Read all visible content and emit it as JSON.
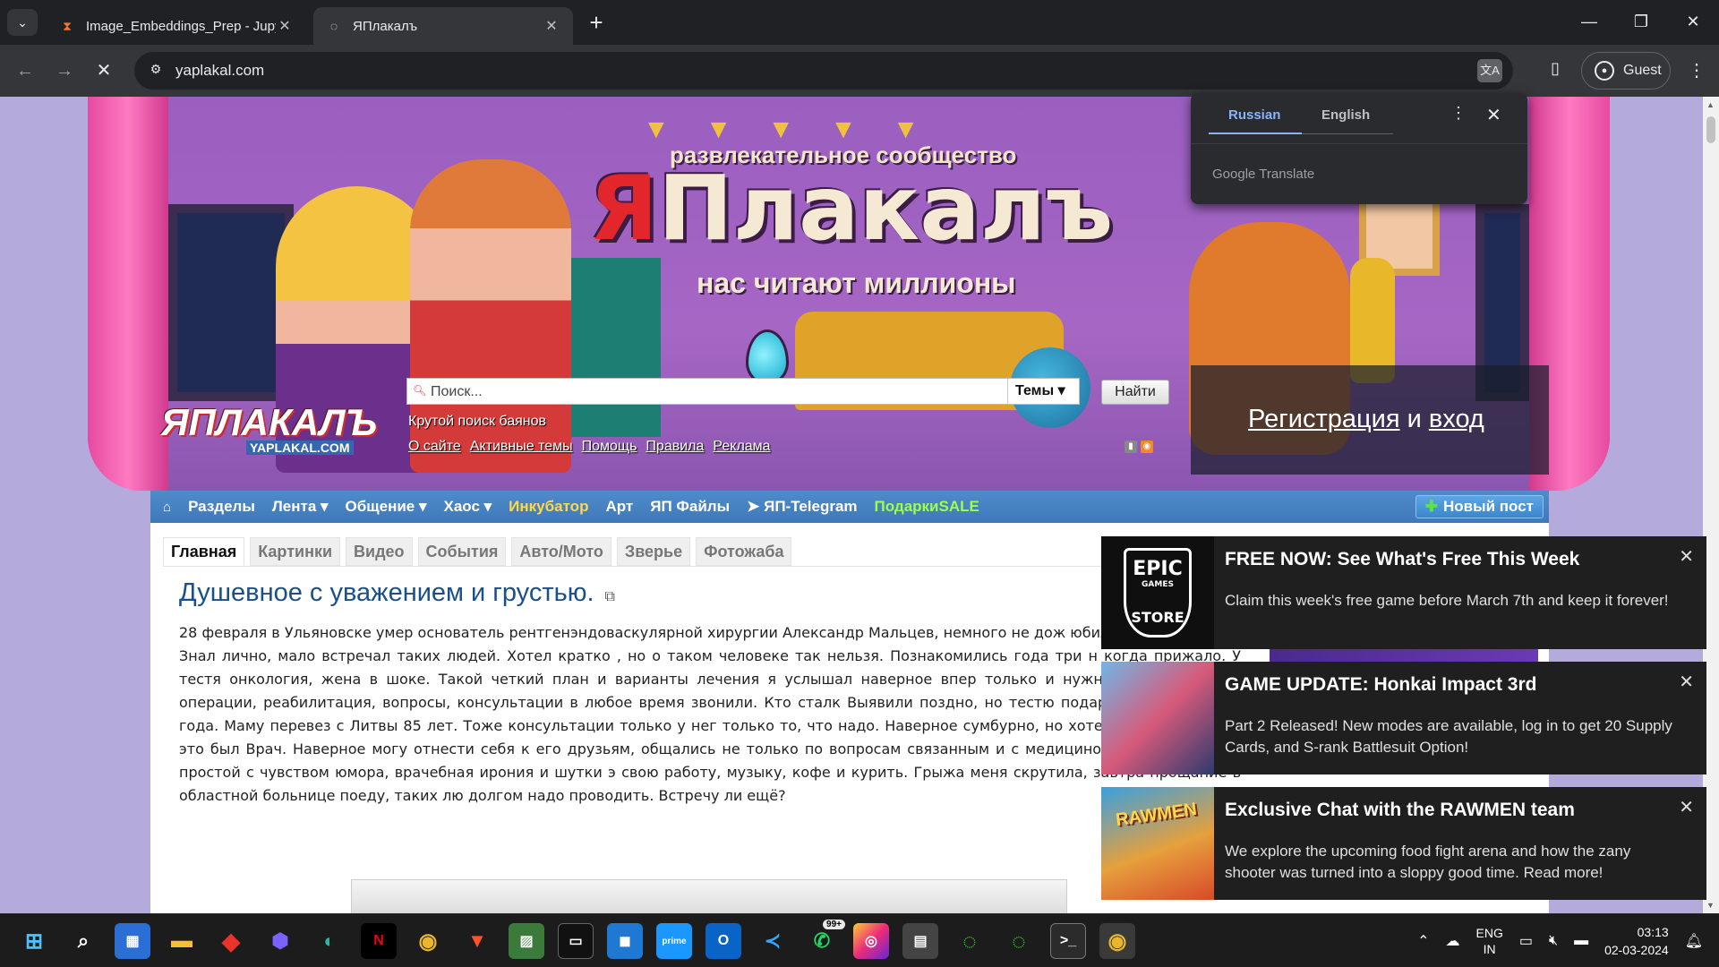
{
  "browser": {
    "tabs": [
      {
        "title": "Image_Embeddings_Prep - Jupy",
        "favicon": "hourglass-icon",
        "active": false
      },
      {
        "title": "ЯПлакалъ",
        "favicon": "loading-icon",
        "active": true
      }
    ],
    "url": "yaplakal.com",
    "profile_label": "Guest"
  },
  "translate_popup": {
    "source_lang": "Russian",
    "target_lang": "English",
    "brand": "Google Translate"
  },
  "banner": {
    "tagline_top": "развлекательное сообщество",
    "brand_first": "Я",
    "brand_rest": "Плакалъ",
    "tagline_bottom": "нас читают миллионы",
    "small_logo_main": "ЯПЛАКАЛ",
    "small_logo_end": "Ъ",
    "small_logo_domain": "YAPLAKAL.COM"
  },
  "search": {
    "placeholder": "Поиск...",
    "scope": "Темы",
    "button": "Найти",
    "subtitle": "Крутой поиск баянов"
  },
  "top_links": [
    "О сайте",
    "Активные темы",
    "Помощь",
    "Правила",
    "Реклама"
  ],
  "auth": {
    "register": "Регистрация",
    "and": "и",
    "login": "вход"
  },
  "nav": {
    "items": [
      {
        "label": "Разделы",
        "style": "normal"
      },
      {
        "label": "Лента ▾",
        "style": "normal"
      },
      {
        "label": "Общение ▾",
        "style": "normal"
      },
      {
        "label": "Хаос ▾",
        "style": "normal"
      },
      {
        "label": "Инкубатор",
        "style": "yellow"
      },
      {
        "label": "Арт",
        "style": "normal"
      },
      {
        "label": "ЯП Файлы",
        "style": "normal"
      },
      {
        "label": "ЯП-Telegram",
        "style": "normal"
      },
      {
        "label": "ПодаркиSALE",
        "style": "green"
      }
    ],
    "new_post": "Новый пост"
  },
  "content_tabs": [
    "Главная",
    "Картинки",
    "Видео",
    "События",
    "Авто/Мото",
    "Зверье",
    "Фотожаба"
  ],
  "post": {
    "title": "Душевное с уважением и грустью.",
    "paragraphs": [
      "28 февраля в Ульяновске умер основатель рентгенэндоваскулярной хирургии Александр Мальцев, немного не дож юбилея.",
      "Знал лично, мало встречал таких людей. Хотел кратко , но о таком человеке так нельзя. Познакомились года три н когда прижало. У тестя онкология, жена в шоке. Такой четкий план и варианты лечения я услышал наверное впер только и нужно было. Анализы, операции, реабилитация, вопросы, консультации в любое время звонили. Кто сталк Выявили поздно, но тестю подарили ещё полтора года. Маму перевез с Литвы 85 лет. Тоже консультации только у нег только то, что надо. Наверное сумбурно, но хотел бы донести ,что это был Врач. Наверное могу отнести себя к его друзьям, общались не только по вопросам связанным и с медициной. В общении был простой с чувством юмора, врачебная ирония и шутки э свою работу, музыку, кофе и курить. Грыжа меня скрутила, завтра прощание в областной больнице поеду, таких лю долгом надо проводить. Встречу ли ещё?"
    ]
  },
  "notifications": [
    {
      "title": "FREE NOW: See What's Free This Week",
      "body": "Claim this week's free game before March 7th and keep it forever!",
      "icon": "epic-games-store-logo"
    },
    {
      "title": "GAME UPDATE: Honkai Impact 3rd",
      "body": "Part 2 Released! New modes are available, log in to get 20 Supply Cards, and S-rank Battlesuit Option!",
      "icon": "honkai-impact-thumbnail"
    },
    {
      "title": "Exclusive Chat with the RAWMEN team",
      "body": "We explore the upcoming food fight arena and how the zany shooter was turned into a sloppy good time. Read more!",
      "icon": "rawmen-thumbnail",
      "thumb_label": "RAWMEN"
    }
  ],
  "epic_logo": {
    "line1": "EPIC",
    "line2": "GAMES",
    "line3": "STORE"
  },
  "taskbar": {
    "whatsapp_badge": "99+",
    "lang_line1": "ENG",
    "lang_line2": "IN",
    "time": "03:13",
    "date": "02-03-2024"
  }
}
